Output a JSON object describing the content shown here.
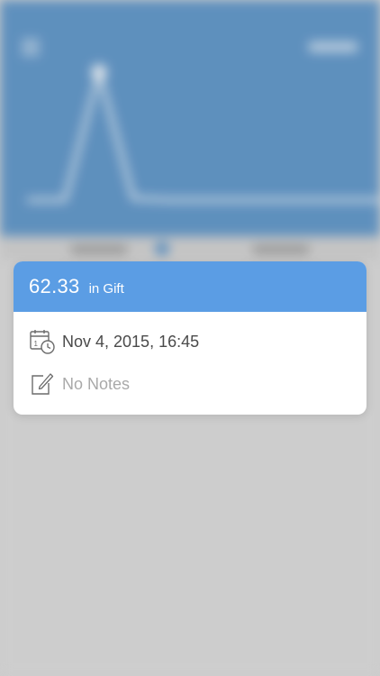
{
  "popup": {
    "amount": "62.33",
    "category": "in Gift",
    "date": "Nov 4, 2015, 16:45",
    "notes": "No Notes",
    "date_icon": "calendar-clock-icon",
    "notes_icon": "edit-note-icon"
  },
  "colors": {
    "header_blue": "#5b9de4",
    "background_blue": "#5b93c7",
    "date_text": "#4a4a4a",
    "notes_text": "#a9a9a9"
  }
}
